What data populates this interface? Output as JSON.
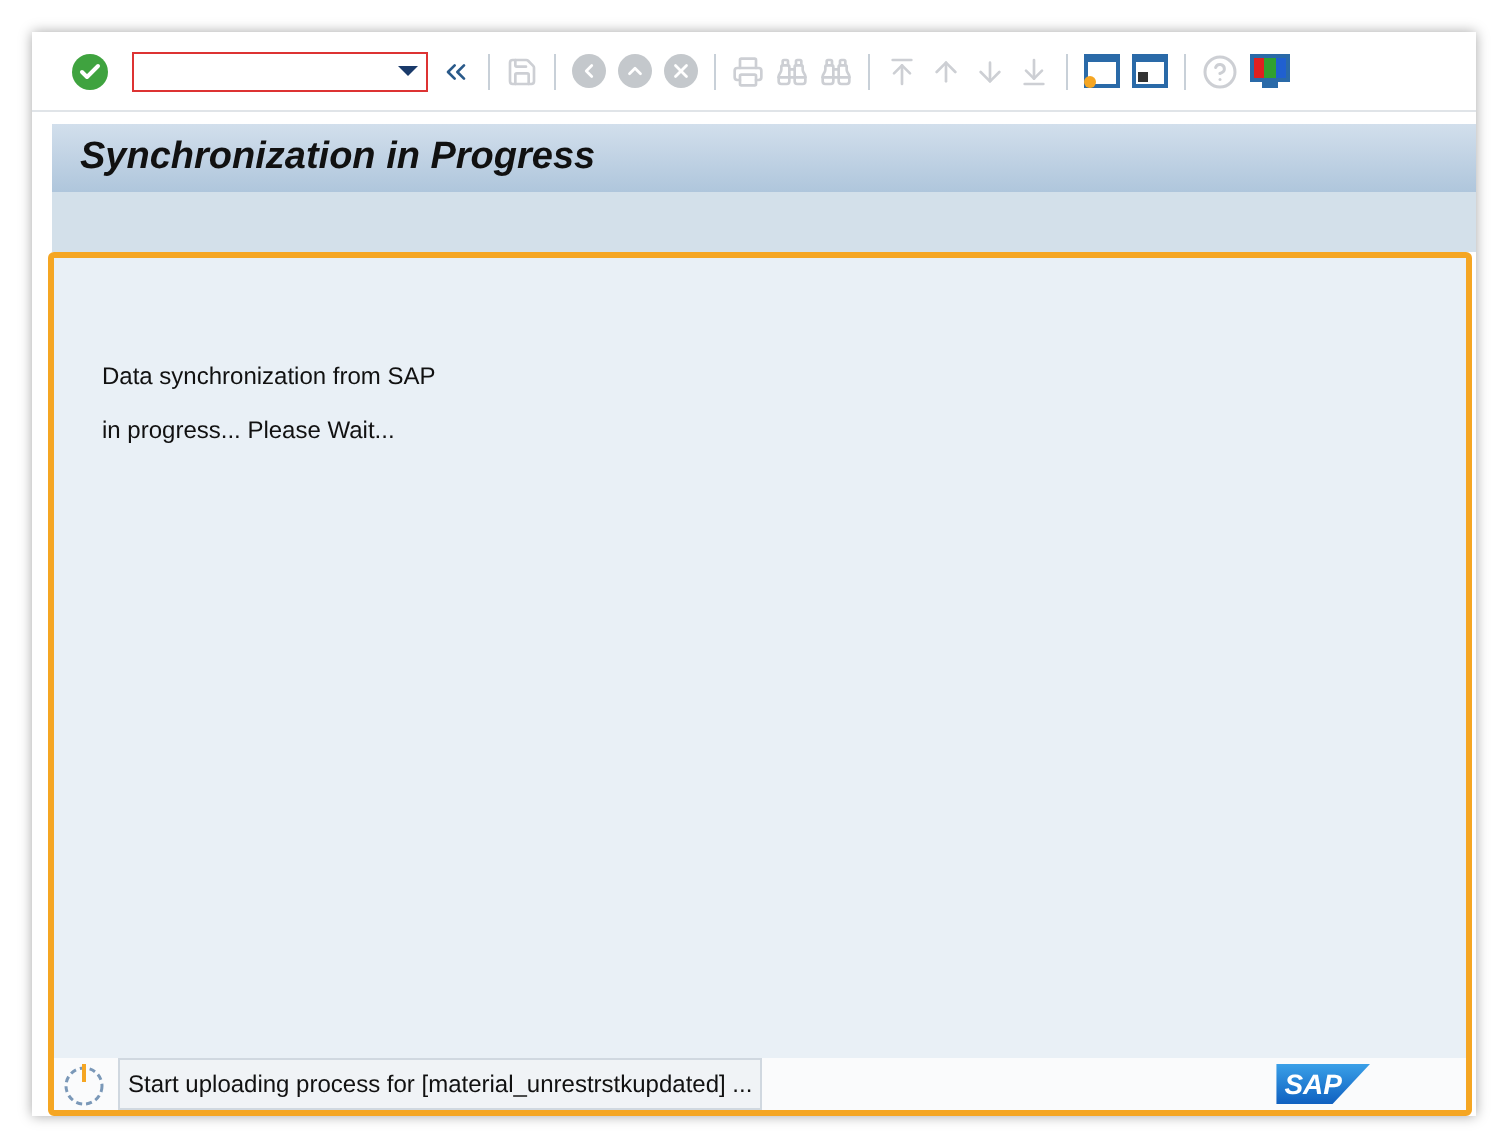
{
  "toolbar": {
    "groups": [
      [
        {
          "kind": "enter",
          "disabled": false
        },
        {
          "kind": "command",
          "disabled": false
        },
        {
          "kind": "collapse",
          "disabled": false
        }
      ],
      [
        {
          "kind": "save",
          "disabled": true
        }
      ],
      [
        {
          "kind": "back",
          "disabled": true
        },
        {
          "kind": "exit",
          "disabled": true
        },
        {
          "kind": "cancel",
          "disabled": true
        }
      ],
      [
        {
          "kind": "print",
          "disabled": true
        },
        {
          "kind": "find",
          "disabled": true
        },
        {
          "kind": "findnext",
          "disabled": true
        }
      ],
      [
        {
          "kind": "first",
          "disabled": true
        },
        {
          "kind": "prev",
          "disabled": true
        },
        {
          "kind": "next",
          "disabled": true
        },
        {
          "kind": "last",
          "disabled": true
        }
      ],
      [
        {
          "kind": "newsession",
          "disabled": false
        },
        {
          "kind": "shortcut",
          "disabled": false
        }
      ],
      [
        {
          "kind": "help",
          "disabled": true
        },
        {
          "kind": "layout",
          "disabled": false
        }
      ]
    ]
  },
  "title": "Synchronization in Progress",
  "message": [
    "Data synchronization from SAP",
    "in progress... Please Wait..."
  ],
  "status_bar": {
    "text": "Start uploading process for [material_unrestrstkupdated] ...",
    "logo": "SAP"
  }
}
